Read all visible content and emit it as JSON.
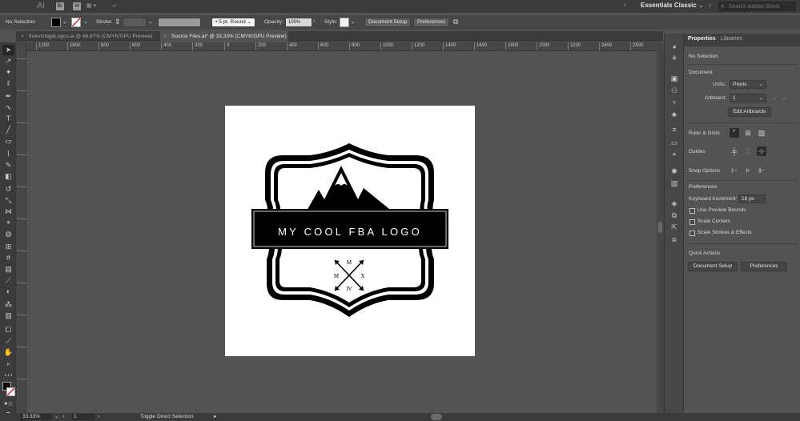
{
  "app": {
    "logo": "Ai",
    "bridge_label": "Br",
    "stock_label": "St",
    "workspace": "Essentials Classic",
    "search_placeholder": "Search Adobe Stock"
  },
  "controlbar": {
    "selection": "No Selection",
    "stroke_label": "Stroke:",
    "brush_value": "5 pt. Round",
    "opacity_label": "Opacity:",
    "opacity_value": "100%",
    "style_label": "Style:",
    "document_setup": "Document Setup",
    "preferences": "Preferences"
  },
  "tabs": [
    {
      "label": "freevintageLogos.ai @ 66.67% (CMYK/GPU Preview)",
      "active": false
    },
    {
      "label": "Source Files.ai* @ 33.33% (CMYK/GPU Preview)",
      "active": true
    }
  ],
  "ruler": {
    "ticks": [
      "1200",
      "1600",
      "800",
      "600",
      "400",
      "200",
      "0",
      "200",
      "400",
      "600",
      "800",
      "1000",
      "1200",
      "1400",
      "1600",
      "1800",
      "2000",
      "2200",
      "2400",
      "2500"
    ]
  },
  "artwork": {
    "title": "MY COOL FBA LOGO",
    "num_top": "M",
    "num_left": "M",
    "num_right": "X",
    "num_bottom": "IV"
  },
  "status": {
    "zoom": "33.33%",
    "artboard": "1",
    "tool_hint": "Toggle Direct Selection"
  },
  "panel": {
    "tab_properties": "Properties",
    "tab_libraries": "Libraries",
    "no_selection": "No Selection",
    "document_heading": "Document",
    "units_label": "Units:",
    "units_value": "Pixels",
    "artboard_label": "Artboard:",
    "artboard_value": "1",
    "edit_artboards": "Edit Artboards",
    "rulers_grids": "Ruler & Grids",
    "guides": "Guides",
    "snap_options": "Snap Options",
    "preferences_heading": "Preferences",
    "keyboard_increment_label": "Keyboard Increment:",
    "keyboard_increment_value": "18 px",
    "use_preview_bounds": "Use Preview Bounds",
    "scale_corners": "Scale Corners",
    "scale_strokes": "Scale Strokes & Effects",
    "quick_actions": "Quick Actions",
    "qa_document_setup": "Document Setup",
    "qa_preferences": "Preferences"
  },
  "colors": {
    "ui_dark": "#3b3b3b",
    "ui_mid": "#474747",
    "canvas": "#535353",
    "artboard": "#ffffff",
    "logo": "#000000"
  }
}
